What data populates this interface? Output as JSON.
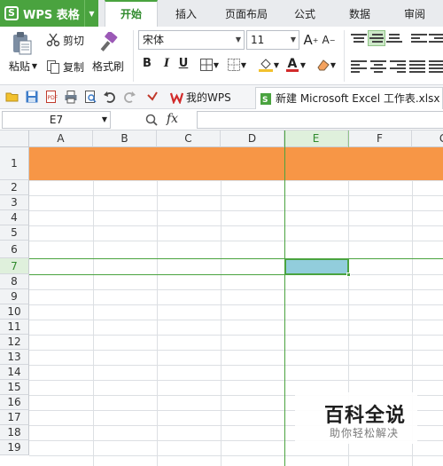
{
  "app": {
    "name": "WPS 表格",
    "logo_letter": "S"
  },
  "menu_tabs": [
    {
      "label": "开始"
    },
    {
      "label": "插入"
    },
    {
      "label": "页面布局"
    },
    {
      "label": "公式"
    },
    {
      "label": "数据"
    },
    {
      "label": "审阅"
    }
  ],
  "ribbon": {
    "paste_label": "粘贴",
    "cut_label": "剪切",
    "copy_label": "复制",
    "format_painter_label": "格式刷",
    "font_name": "宋体",
    "font_size": "11",
    "bold": "B",
    "italic": "I",
    "underline": "U",
    "font_color_letter": "A",
    "grow_font": "A",
    "shrink_font": "A",
    "accent_color": "#4aa33f",
    "font_color": "#d22b2b",
    "highlight_color": "#f2c12e"
  },
  "quick_access": {
    "doc_tabs": [
      {
        "label": "我的WPS"
      },
      {
        "label": "新建 Microsoft Excel 工作表.xlsx *"
      }
    ]
  },
  "formula_bar": {
    "name_box": "E7",
    "fx_label": "fx",
    "formula": ""
  },
  "sheet": {
    "columns": [
      "A",
      "B",
      "C",
      "D",
      "E",
      "F",
      "G"
    ],
    "rows": [
      "1",
      "2",
      "3",
      "4",
      "5",
      "6",
      "7",
      "8",
      "9",
      "10",
      "11",
      "12",
      "13",
      "14",
      "15",
      "16",
      "17",
      "18",
      "19"
    ],
    "selected_cell": "E7",
    "row1_fill": "#f79646",
    "selected_fill": "#92cddc",
    "selection_color": "#4aa33f"
  },
  "watermark": {
    "title": "百科全说",
    "subtitle": "助你轻松解决"
  }
}
